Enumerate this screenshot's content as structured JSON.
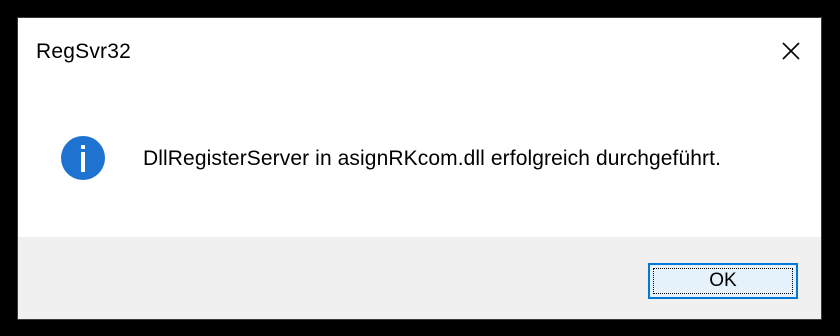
{
  "window": {
    "title": "RegSvr32",
    "close_icon": "close-icon"
  },
  "message": {
    "icon": "info-icon",
    "text": "DllRegisterServer in asignRKcom.dll erfolgreich durchgeführt."
  },
  "buttons": {
    "ok_label": "OK"
  },
  "colors": {
    "info_icon_bg": "#1e73d0",
    "ok_border": "#0078d7",
    "footer_bg": "#f0f0f0"
  }
}
